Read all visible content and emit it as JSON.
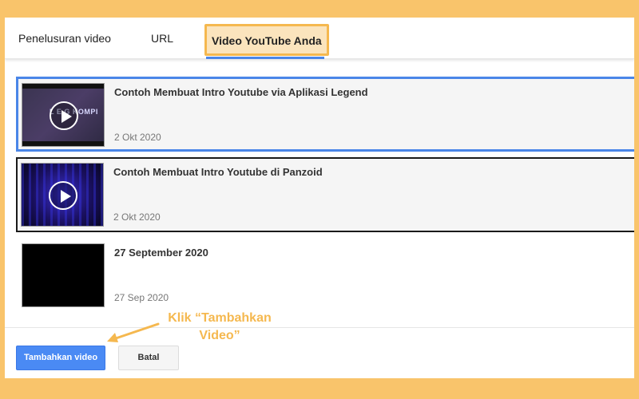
{
  "tabs": [
    {
      "label": "Penelusuran video"
    },
    {
      "label": "URL"
    },
    {
      "label": "Video YouTube Anda"
    }
  ],
  "videos": [
    {
      "title": "Contoh Membuat Intro Youtube via Aplikasi Legend",
      "date": "2 Okt 2020",
      "thumb_text": "L E G KOMPI"
    },
    {
      "title": "Contoh Membuat Intro Youtube di Panzoid",
      "date": "2 Okt 2020"
    },
    {
      "title": "27 September 2020",
      "date": "27 Sep 2020"
    }
  ],
  "footer": {
    "add_label": "Tambahkan video",
    "cancel_label": "Batal"
  },
  "annotation": {
    "line1": "Klik “Tambahkan",
    "line2": "Video”"
  },
  "colors": {
    "background": "#f9c46b",
    "highlight": "#f5b84f",
    "accent": "#4a86e8",
    "button_primary": "#4a8af4"
  }
}
